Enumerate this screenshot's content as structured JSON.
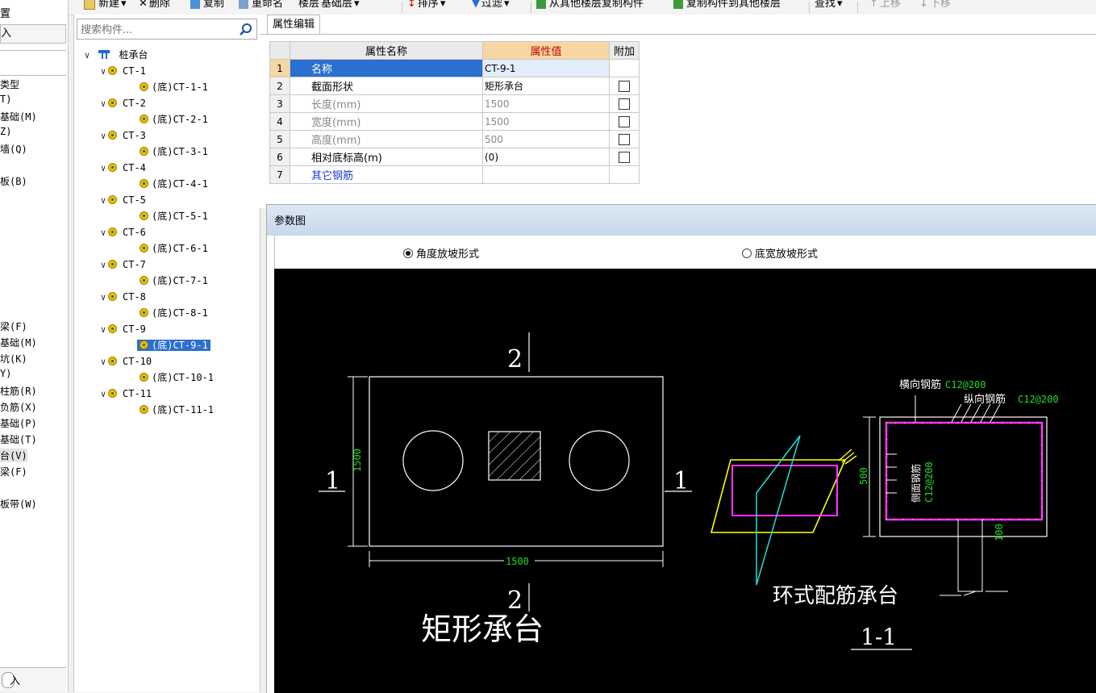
{
  "toolbar": {
    "new": "新建",
    "delete": "删除",
    "copy": "复制",
    "rename": "重命名",
    "floor_label": "楼层",
    "floor_value": "基础层",
    "sort": "排序",
    "filter": "过滤",
    "copy_from_other": "从其他楼层复制构件",
    "copy_to_other": "复制构件到其他楼层",
    "find": "查找",
    "move_up": "上移",
    "move_down": "下移"
  },
  "left_panel": {
    "title": "置",
    "box_label": "入",
    "items": [
      "类型",
      "T)",
      "基础(M)",
      "Z)",
      "墙(Q)",
      "板(B)",
      "梁(F)",
      "基础(M)",
      "坑(K)",
      "Y)",
      "柱筋(R)",
      "负筋(X)",
      "基础(P)",
      "基础(T)",
      "台(V)",
      "梁(F)",
      "板带(W)"
    ],
    "bottom_label": "入"
  },
  "tree": {
    "search_placeholder": "搜索构件...",
    "root": "桩承台",
    "groups": [
      {
        "name": "CT-1",
        "child": "(底)CT-1-1"
      },
      {
        "name": "CT-2",
        "child": "(底)CT-2-1"
      },
      {
        "name": "CT-3",
        "child": "(底)CT-3-1"
      },
      {
        "name": "CT-4",
        "child": "(底)CT-4-1"
      },
      {
        "name": "CT-5",
        "child": "(底)CT-5-1"
      },
      {
        "name": "CT-6",
        "child": "(底)CT-6-1"
      },
      {
        "name": "CT-7",
        "child": "(底)CT-7-1"
      },
      {
        "name": "CT-8",
        "child": "(底)CT-8-1"
      },
      {
        "name": "CT-9",
        "child": "(底)CT-9-1"
      },
      {
        "name": "CT-10",
        "child": "(底)CT-10-1"
      },
      {
        "name": "CT-11",
        "child": "(底)CT-11-1"
      }
    ],
    "selected": "(底)CT-9-1"
  },
  "properties": {
    "tab": "属性编辑",
    "headers": {
      "name": "属性名称",
      "value": "属性值",
      "extra": "附加"
    },
    "rows": [
      {
        "num": "1",
        "name": "名称",
        "value": "CT-9-1"
      },
      {
        "num": "2",
        "name": "截面形状",
        "value": "矩形承台"
      },
      {
        "num": "3",
        "name": "长度(mm)",
        "value": "1500"
      },
      {
        "num": "4",
        "name": "宽度(mm)",
        "value": "1500"
      },
      {
        "num": "5",
        "name": "高度(mm)",
        "value": "500"
      },
      {
        "num": "6",
        "name": "相对底标高(m)",
        "value": "(0)"
      },
      {
        "num": "7",
        "name": "其它钢筋",
        "value": ""
      }
    ]
  },
  "diagram": {
    "title": "参数图",
    "radio_angle": "角度放坡形式",
    "radio_width": "底宽放坡形式",
    "plan": {
      "label_top": "2",
      "label_bottom": "2",
      "label_left": "1",
      "label_right": "1",
      "dim_height": "1500",
      "dim_width": "1500",
      "caption": "矩形承台"
    },
    "section": {
      "transverse_label": "横向钢筋",
      "transverse_value": "C12@200",
      "longitudinal_label": "纵向钢筋",
      "longitudinal_value": "C12@200",
      "side_label": "侧面钢筋",
      "side_value": "C12@200",
      "dim_height": "500",
      "dim_cover": "100",
      "caption": "环式配筋承台",
      "section_label": "1-1"
    },
    "colors": {
      "bg": "#000000",
      "line": "#ffffff",
      "dim": "#22dd22",
      "rebar": "#ff33ff",
      "yellow": "#ffff00",
      "cyan": "#22dddd"
    }
  }
}
